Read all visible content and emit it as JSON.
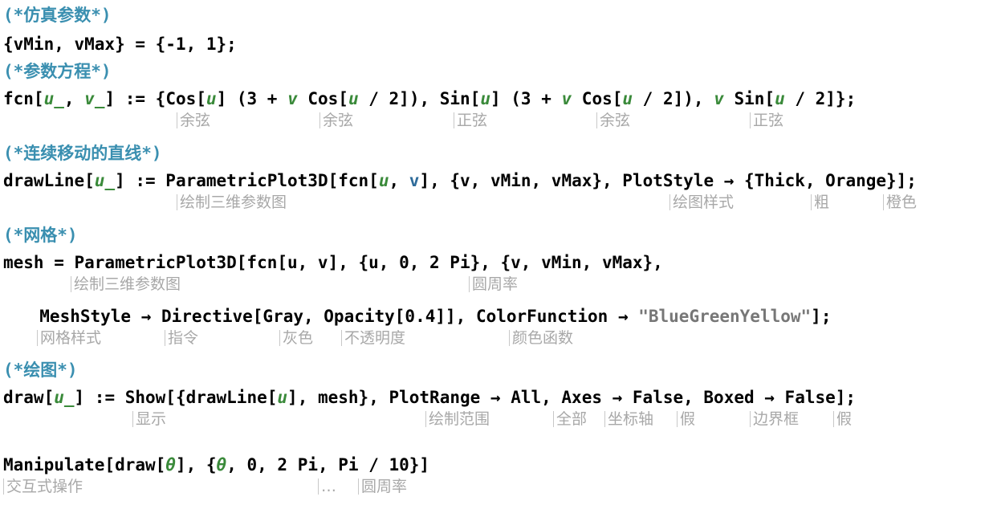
{
  "comments": {
    "sim_params": "(*仿真参数*)",
    "param_eq": "(*参数方程*)",
    "moving_line": "(*连续移动的直线*)",
    "mesh": "(*网格*)",
    "plot": "(*绘图*)"
  },
  "code": {
    "l1": "{vMin, vMax} = {-1, 1};",
    "fcn_head": "fcn[",
    "u_": "u_",
    "comma1": ", ",
    "v_": "v_",
    "fcn_def": "] := {Cos[",
    "u": "u",
    "v": "v",
    "fcn_a": "] (3 + ",
    "fcn_b": " Cos[",
    "fcn_c": " / 2]), Sin[",
    "fcn_d": " / 2]), ",
    "fcn_e": " Sin[",
    "fcn_f": " / 2]};",
    "drawline_head": "drawLine[",
    "drawline_mid": "] := ParametricPlot3D[fcn[",
    "drawline_mid2": "], {v, vMin, vMax}, PlotStyle → {Thick, Orange}];",
    "mesh_line1": "mesh = ParametricPlot3D[fcn[u, v], {u, 0, 2 Pi}, {v, vMin, vMax},",
    "mesh_line2_a": "  MeshStyle → Directive[Gray, Opacity[0.4]], ColorFunction → ",
    "mesh_line2_str": "\"BlueGreenYellow\"",
    "mesh_line2_b": "];",
    "draw_head": "draw[",
    "draw_mid": "] := Show[{drawLine[",
    "draw_tail": "], mesh}, PlotRange → All, Axes → False, Boxed → False];",
    "manip_a": "Manipulate[draw[",
    "theta": "θ",
    "manip_b": "], {",
    "manip_c": ", 0, 2 Pi, Pi / 10}]"
  },
  "hints": {
    "cos1": "余弦",
    "cos2": "余弦",
    "sin1": "正弦",
    "cos3": "余弦",
    "sin2": "正弦",
    "pp3d1": "绘制三维参数图",
    "plotstyle": "绘图样式",
    "thick": "粗",
    "orange": "橙色",
    "pp3d2": "绘制三维参数图",
    "pi1": "圆周率",
    "meshstyle": "网格样式",
    "directive": "指令",
    "gray": "灰色",
    "opacity": "不透明度",
    "colorfn": "颜色函数",
    "show": "显示",
    "plotrange": "绘制范围",
    "all": "全部",
    "axes": "坐标轴",
    "false1": "假",
    "boxed": "边界框",
    "false2": "假",
    "manipulate": "交互式操作",
    "ellipsis": "…",
    "pi2": "圆周率"
  }
}
